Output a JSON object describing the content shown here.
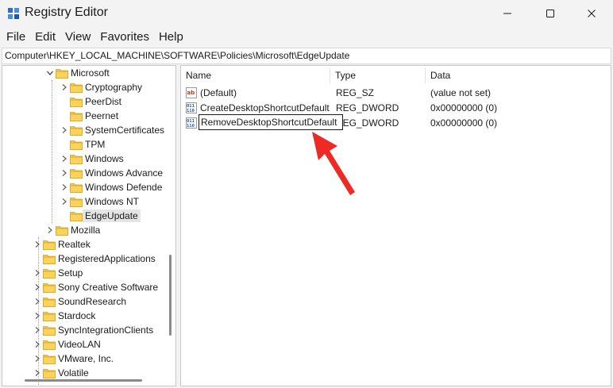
{
  "window": {
    "title": "Registry Editor",
    "icon": "registry-icon",
    "controls": [
      "minimize-icon",
      "maximize-icon",
      "close-icon"
    ]
  },
  "menu": [
    "File",
    "Edit",
    "View",
    "Favorites",
    "Help"
  ],
  "address": "Computer\\HKEY_LOCAL_MACHINE\\SOFTWARE\\Policies\\Microsoft\\EdgeUpdate",
  "tree": {
    "items": [
      {
        "label": "Microsoft",
        "expanded": true
      },
      {
        "label": "Cryptography",
        "expandable": true
      },
      {
        "label": "PeerDist",
        "expandable": false
      },
      {
        "label": "Peernet",
        "expandable": false
      },
      {
        "label": "SystemCertificates",
        "expandable": true
      },
      {
        "label": "TPM",
        "expandable": false
      },
      {
        "label": "Windows",
        "expandable": true
      },
      {
        "label": "Windows Advance",
        "expandable": true
      },
      {
        "label": "Windows Defende",
        "expandable": true
      },
      {
        "label": "Windows NT",
        "expandable": true
      },
      {
        "label": "EdgeUpdate",
        "expandable": false,
        "selected": true
      },
      {
        "label": "Mozilla",
        "expandable": true
      },
      {
        "label": "Realtek",
        "expandable": true
      },
      {
        "label": "RegisteredApplications",
        "expandable": false
      },
      {
        "label": "Setup",
        "expandable": true
      },
      {
        "label": "Sony Creative Software",
        "expandable": true
      },
      {
        "label": "SoundResearch",
        "expandable": true
      },
      {
        "label": "Stardock",
        "expandable": true
      },
      {
        "label": "SyncIntegrationClients",
        "expandable": true
      },
      {
        "label": "VideoLAN",
        "expandable": true
      },
      {
        "label": "VMware, Inc.",
        "expandable": true
      },
      {
        "label": "Volatile",
        "expandable": true
      }
    ]
  },
  "list": {
    "columns": [
      "Name",
      "Type",
      "Data"
    ],
    "rows": [
      {
        "name": "(Default)",
        "type": "REG_SZ",
        "data": "(value not set)",
        "icon": "string-value-icon"
      },
      {
        "name": "CreateDesktopShortcutDefault",
        "type": "REG_DWORD",
        "data": "0x00000000 (0)",
        "icon": "dword-value-icon"
      },
      {
        "name": "RemoveDesktopShortcutDefault",
        "type": "REG_DWORD",
        "data": "0x00000000 (0)",
        "icon": "dword-value-icon",
        "renaming": true
      }
    ]
  },
  "colors": {
    "folder": "#f4c542",
    "annotation_arrow": "#ee2a24",
    "selection": "#e5e5e5"
  }
}
